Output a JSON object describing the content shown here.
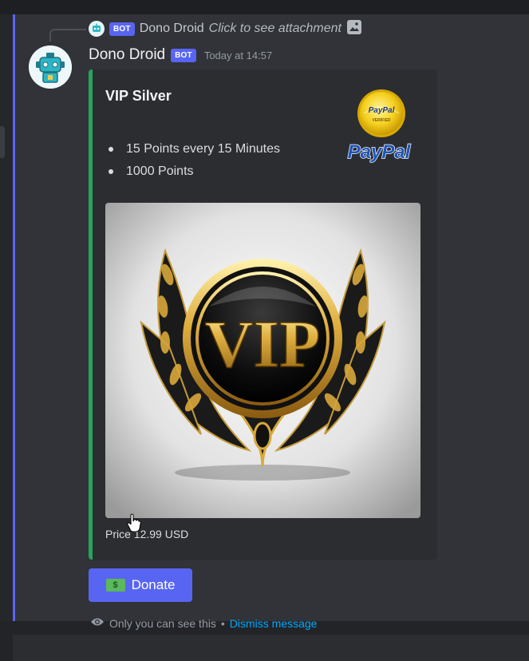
{
  "reply": {
    "bot_tag": "BOT",
    "username": "Dono Droid",
    "text": "Click to see attachment",
    "icon": "image-icon"
  },
  "message": {
    "username": "Dono Droid",
    "bot_tag": "BOT",
    "timestamp": "Today at 14:57",
    "avatar_icon": "robot-avatar-icon"
  },
  "embed": {
    "accent_color": "#23a55a",
    "title": "VIP Silver",
    "items": [
      {
        "text": "15 Points every 15 Minutes"
      },
      {
        "text": "1000 Points"
      }
    ],
    "thumbnail": {
      "seal_top": "PayPal",
      "seal_bottom": "VERIFIED",
      "logo_text": "PayPal"
    },
    "image": {
      "emblem_text": "VIP"
    },
    "footer": "Price 12.99 USD"
  },
  "donate_button": {
    "label": "Donate",
    "icon": "money-icon",
    "color": "#5865f2"
  },
  "ephemeral": {
    "icon": "eye-icon",
    "text": "Only you can see this",
    "separator": "•",
    "dismiss_label": "Dismiss message",
    "link_color": "#00a8fc"
  }
}
